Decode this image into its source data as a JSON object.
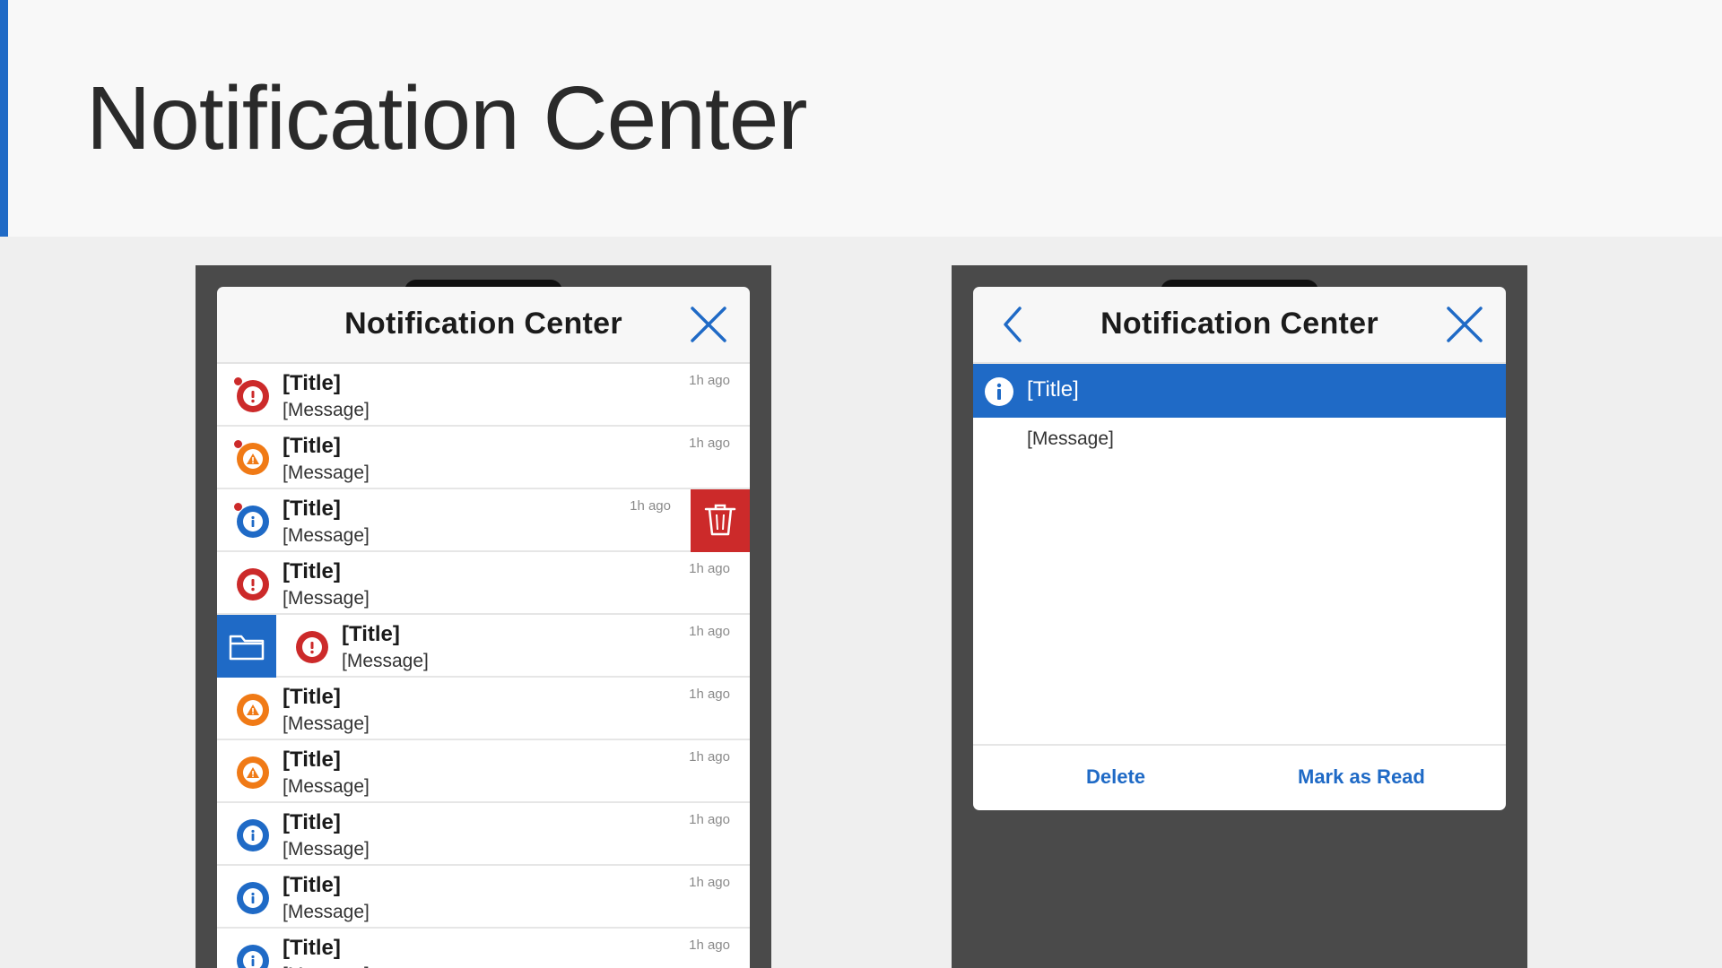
{
  "page": {
    "title": "Notification Center"
  },
  "colors": {
    "accent": "#1f6ac6",
    "error": "#cc2a2a",
    "warning": "#f07a16",
    "info": "#1f6ac6"
  },
  "list_view": {
    "header_title": "Notification Center",
    "close_icon": "close-icon",
    "items": [
      {
        "type": "error",
        "unread": true,
        "title": "[Title]",
        "message": "[Message]",
        "time": "1h ago"
      },
      {
        "type": "warning",
        "unread": true,
        "title": "[Title]",
        "message": "[Message]",
        "time": "1h ago"
      },
      {
        "type": "info",
        "unread": true,
        "title": "[Title]",
        "message": "[Message]",
        "time": "1h ago",
        "swipe_action": "trash-icon"
      },
      {
        "type": "error",
        "unread": false,
        "title": "[Title]",
        "message": "[Message]",
        "time": "1h ago"
      },
      {
        "type": "error",
        "unread": false,
        "title": "[Title]",
        "message": "[Message]",
        "time": "1h ago",
        "swipe_action": "folder-icon"
      },
      {
        "type": "warning",
        "unread": false,
        "title": "[Title]",
        "message": "[Message]",
        "time": "1h ago"
      },
      {
        "type": "warning",
        "unread": false,
        "title": "[Title]",
        "message": "[Message]",
        "time": "1h ago"
      },
      {
        "type": "info",
        "unread": false,
        "title": "[Title]",
        "message": "[Message]",
        "time": "1h ago"
      },
      {
        "type": "info",
        "unread": false,
        "title": "[Title]",
        "message": "[Message]",
        "time": "1h ago"
      },
      {
        "type": "info",
        "unread": false,
        "title": "[Title]",
        "message": "[Message]",
        "time": "1h ago"
      }
    ]
  },
  "detail_view": {
    "header_title": "Notification Center",
    "back_icon": "chevron-left-icon",
    "close_icon": "close-icon",
    "notification": {
      "type": "info",
      "title": "[Title]",
      "message": "[Message]"
    },
    "actions": {
      "delete_label": "Delete",
      "mark_read_label": "Mark as Read"
    }
  }
}
